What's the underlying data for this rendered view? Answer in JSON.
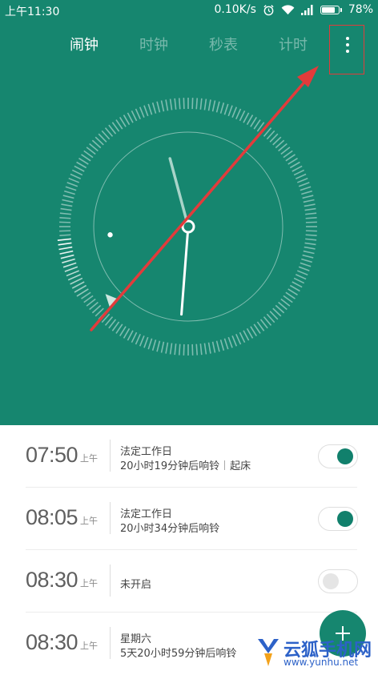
{
  "status_bar": {
    "time": "上午11:30",
    "speed": "0.10K/s",
    "battery": "78%",
    "battery_level": 0.78,
    "icons": [
      "alarm-icon",
      "wifi-icon",
      "signal-icon",
      "battery-icon"
    ]
  },
  "tabs": [
    {
      "label": "闹钟",
      "active": true
    },
    {
      "label": "时钟",
      "active": false
    },
    {
      "label": "秒表",
      "active": false
    },
    {
      "label": "计时",
      "active": false
    }
  ],
  "menu": {
    "icon": "more-vertical-icon"
  },
  "clock": {
    "hour": 11,
    "minute": 30,
    "second": 44
  },
  "alarms": [
    {
      "time": "07:50",
      "ampm": "上午",
      "repeat": "法定工作日",
      "remaining": "20小时19分钟后响铃",
      "label": "起床",
      "enabled": true
    },
    {
      "time": "08:05",
      "ampm": "上午",
      "repeat": "法定工作日",
      "remaining": "20小时34分钟后响铃",
      "label": "",
      "enabled": true
    },
    {
      "time": "08:30",
      "ampm": "上午",
      "repeat": "未开启",
      "remaining": "",
      "label": "",
      "enabled": false
    },
    {
      "time": "08:30",
      "ampm": "上午",
      "repeat": "星期六",
      "remaining": "5天20小时59分钟后响铃",
      "label": "",
      "enabled": true
    }
  ],
  "fab": {
    "icon": "plus-icon"
  },
  "watermark": {
    "name": "云狐手机网",
    "url": "www.yunhu.net"
  },
  "colors": {
    "primary": "#16866f",
    "annotation": "#e23b3b",
    "toggle_on": "#11806c"
  }
}
